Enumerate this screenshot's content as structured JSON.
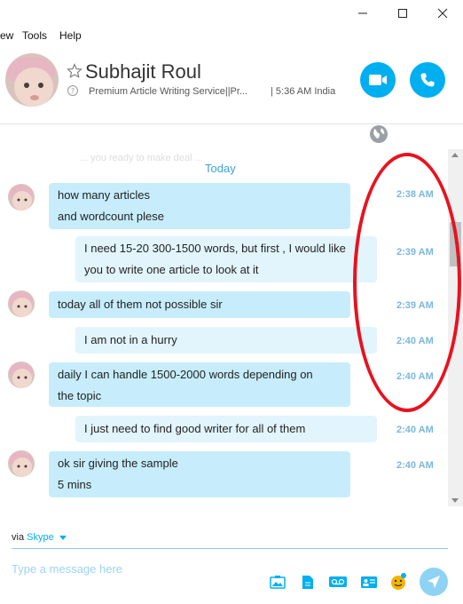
{
  "menu": {
    "view": "ew",
    "tools": "Tools",
    "help": "Help"
  },
  "contact": {
    "name": "Subhajit Roul",
    "mood": "Premium Article Writing Service||Pr...",
    "local_time": "| 5:36 AM India"
  },
  "chat": {
    "faded_text": "... you ready to make deal ...",
    "day_separator": "Today",
    "messages": [
      {
        "direction": "in",
        "lines": [
          "how many articles",
          "and wordcount plese"
        ],
        "time": "2:38 AM"
      },
      {
        "direction": "out",
        "lines": [
          "I need 15-20 300-1500 words, but first , I would like",
          "you to write one article to look at it"
        ],
        "time": "2:39 AM"
      },
      {
        "direction": "in",
        "lines": [
          "today all of them not possible sir"
        ],
        "time": "2:39 AM"
      },
      {
        "direction": "out",
        "lines": [
          "I am not in a hurry"
        ],
        "time": "2:40 AM"
      },
      {
        "direction": "in",
        "lines": [
          "daily I can handle 1500-2000 words depending on",
          "the topic"
        ],
        "time": "2:40 AM"
      },
      {
        "direction": "out",
        "lines": [
          "I just need to find good writer for all of them"
        ],
        "time": "2:40 AM"
      },
      {
        "direction": "in",
        "lines": [
          "ok sir giving the sample",
          "5 mins"
        ],
        "time": "2:40 AM"
      }
    ]
  },
  "composer": {
    "via_label": "via",
    "via_service": "Skype",
    "placeholder": "Type a message here"
  },
  "colors": {
    "accent": "#00aff0",
    "incoming_bubble": "#c7edfc",
    "outgoing_bubble": "#e2f5fd",
    "annotation": "#e8121f"
  },
  "icons": [
    "minimize-icon",
    "maximize-icon",
    "close-icon",
    "star-icon",
    "mood-icon",
    "video-call-icon",
    "phone-icon",
    "globe-icon",
    "photo-icon",
    "file-icon",
    "voicemail-icon",
    "contact-card-icon",
    "emoticon-icon",
    "send-icon"
  ]
}
